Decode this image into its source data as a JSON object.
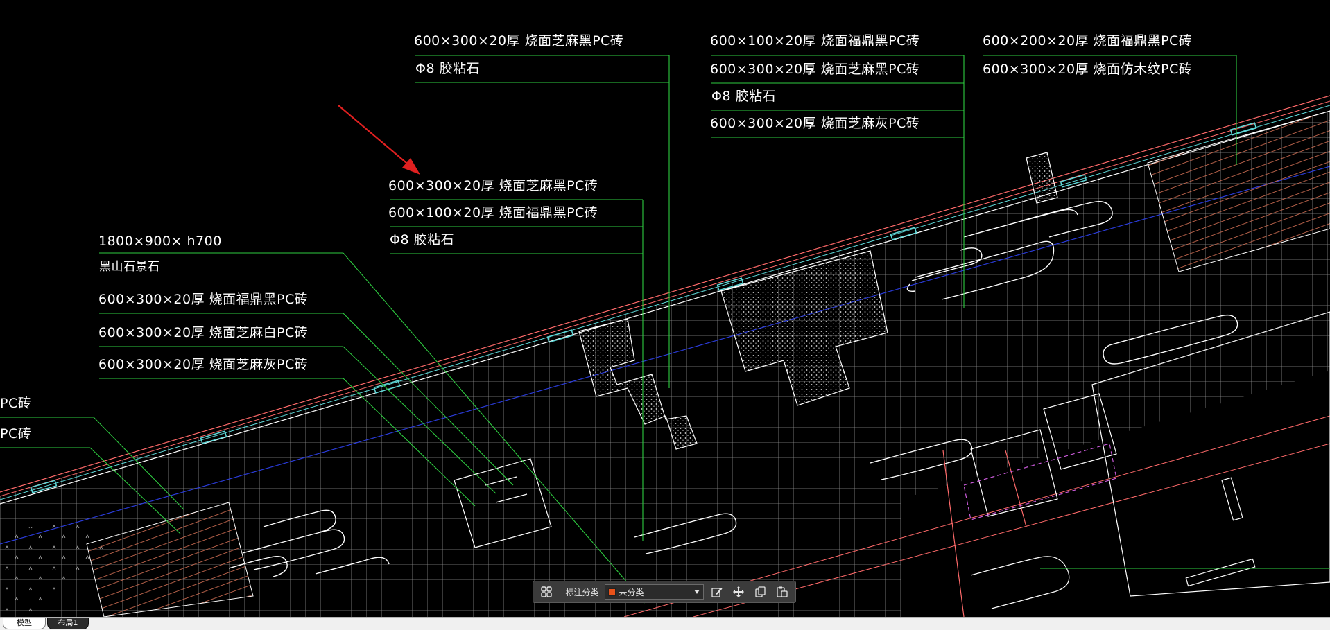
{
  "labels": {
    "top_a": [
      "600×300×20厚 烧面芝麻黑PC砖",
      "Φ8 胶粘石"
    ],
    "top_b": [
      "600×100×20厚 烧面福鼎黑PC砖",
      "600×300×20厚 烧面芝麻黑PC砖",
      "Φ8 胶粘石",
      "600×300×20厚 烧面芝麻灰PC砖"
    ],
    "top_c": [
      "600×200×20厚 烧面福鼎黑PC砖",
      "600×300×20厚 烧面仿木纹PC砖"
    ],
    "mid": [
      "600×300×20厚 烧面芝麻黑PC砖",
      "600×100×20厚 烧面福鼎黑PC砖",
      "Φ8 胶粘石"
    ],
    "left": [
      "1800×900× h700",
      "黑山石景石",
      "600×300×20厚 烧面福鼎黑PC砖",
      "600×300×20厚 烧面芝麻白PC砖",
      "600×300×20厚 烧面芝麻灰PC砖"
    ],
    "edge": [
      "PC砖",
      "PC砖"
    ]
  },
  "toolbar": {
    "category_label": "标注分类",
    "category_value": "未分类",
    "category_color": "#e8521a",
    "icons": [
      "grid-icon",
      "edit-icon",
      "move-icon",
      "copy-icon",
      "paste-icon"
    ]
  },
  "tabs": {
    "model": "模型",
    "layout1": "布局1"
  },
  "colors": {
    "background": "#000000",
    "leader": "#2ecc40",
    "grid": "#9a9a9a",
    "outline": "#ffffff",
    "edge_red": "#ff6a6a",
    "axis_blue": "#2a3bd8",
    "arrow": "#e02020",
    "cyan": "#5fd8d8"
  }
}
